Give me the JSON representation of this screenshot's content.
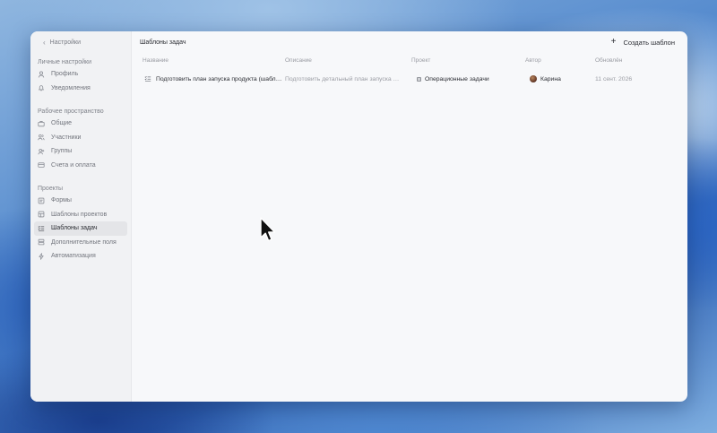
{
  "sidebar": {
    "back_label": "Настройки",
    "sections": [
      {
        "title": "Личные настройки",
        "items": [
          {
            "label": "Профиль",
            "icon": "user-icon"
          },
          {
            "label": "Уведомления",
            "icon": "bell-icon"
          }
        ]
      },
      {
        "title": "Рабочее пространство",
        "items": [
          {
            "label": "Общие",
            "icon": "briefcase-icon"
          },
          {
            "label": "Участники",
            "icon": "users-icon"
          },
          {
            "label": "Группы",
            "icon": "group-icon"
          },
          {
            "label": "Счета и оплата",
            "icon": "card-icon"
          }
        ]
      },
      {
        "title": "Проекты",
        "items": [
          {
            "label": "Формы",
            "icon": "form-icon"
          },
          {
            "label": "Шаблоны проектов",
            "icon": "template-icon"
          },
          {
            "label": "Шаблоны задач",
            "icon": "task-template-icon",
            "active": true
          },
          {
            "label": "Дополнительные поля",
            "icon": "fields-icon"
          },
          {
            "label": "Автоматизация",
            "icon": "bolt-icon"
          }
        ]
      }
    ]
  },
  "header": {
    "title": "Шаблоны задач",
    "create_button": "Создать шаблон"
  },
  "table": {
    "columns": [
      "Название",
      "Описание",
      "Проект",
      "Автор",
      "Обновлён"
    ],
    "rows": [
      {
        "name": "Подготовить план запуска продукта (шабл…",
        "description": "Подготовить детальный план запуска нов…",
        "project": "Операционные задачи",
        "author": "Карина",
        "updated": "11 сент. 2026"
      }
    ]
  },
  "colors": {
    "window_bg": "#f7f8fa",
    "sidebar_bg": "#f1f2f4",
    "active_item_bg": "#e4e5e8",
    "text_primary": "#2b2d33",
    "text_muted": "#9a9ca3"
  }
}
